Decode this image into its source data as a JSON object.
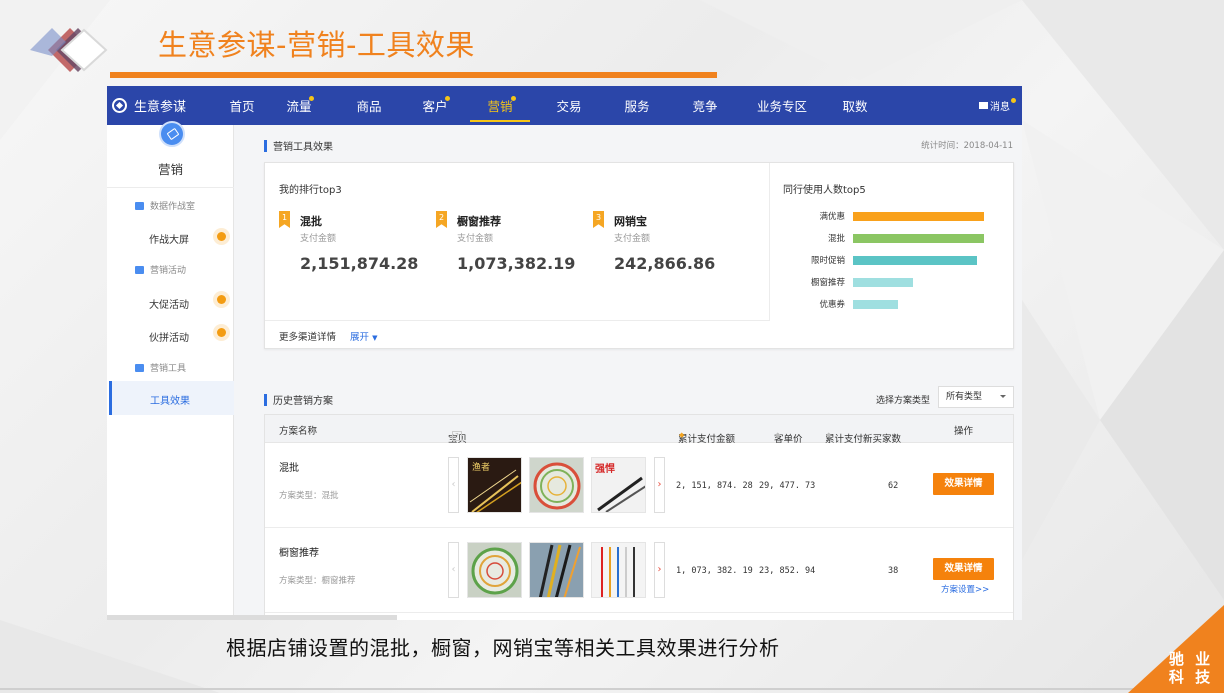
{
  "slide": {
    "title": "生意参谋-营销-工具效果",
    "caption": "根据店铺设置的混批，橱窗，网销宝等相关工具效果进行分析",
    "corner_line1": "驰 业",
    "corner_line2": "科 技",
    "accent": "#f0821e"
  },
  "navbar": {
    "brand": "生意参谋",
    "items": [
      {
        "label": "首页",
        "dot": false,
        "active": false
      },
      {
        "label": "流量",
        "dot": true,
        "active": false
      },
      {
        "label": "商品",
        "dot": false,
        "active": false
      },
      {
        "label": "客户",
        "dot": true,
        "active": false
      },
      {
        "label": "营销",
        "dot": true,
        "active": true
      },
      {
        "label": "交易",
        "dot": false,
        "active": false
      },
      {
        "label": "服务",
        "dot": false,
        "active": false
      },
      {
        "label": "竞争",
        "dot": false,
        "active": false
      },
      {
        "label": "业务专区",
        "dot": false,
        "active": false
      },
      {
        "label": "取数",
        "dot": false,
        "active": false
      }
    ],
    "message": "消息",
    "bg": "#2b46a9"
  },
  "sidebar": {
    "title": "营销",
    "groups": [
      {
        "label": "数据作战室",
        "links": [
          {
            "label": "作战大屏",
            "dot": true
          }
        ]
      },
      {
        "label": "营销活动",
        "links": [
          {
            "label": "大促活动",
            "dot": true
          },
          {
            "label": "伙拼活动",
            "dot": true
          }
        ]
      },
      {
        "label": "营销工具",
        "links": [
          {
            "label": "工具效果",
            "active": true
          }
        ]
      }
    ]
  },
  "tool_effect": {
    "heading": "营销工具效果",
    "stat_time": "统计时间：2018-04-11",
    "my_rank_title": "我的排行top3",
    "ranks": [
      {
        "badge": "1",
        "name": "混批",
        "sub": "支付金额",
        "amount": "2,151,874.28"
      },
      {
        "badge": "2",
        "name": "橱窗推荐",
        "sub": "支付金额",
        "amount": "1,073,382.19"
      },
      {
        "badge": "3",
        "name": "网销宝",
        "sub": "支付金额",
        "amount": "242,866.86"
      }
    ],
    "more_channels": "更多渠道详情",
    "expand": "展开"
  },
  "chart_data": {
    "type": "bar",
    "orientation": "horizontal",
    "title": "同行使用人数top5",
    "categories": [
      "满优惠",
      "混批",
      "限时促销",
      "橱窗推荐",
      "优惠券"
    ],
    "values": [
      100,
      100,
      95,
      46,
      34
    ],
    "colors": [
      "#f9a11b",
      "#8bc663",
      "#5bc4c5",
      "#9fdfe0",
      "#9fdfe0"
    ],
    "xlim": [
      0,
      100
    ],
    "grid": false
  },
  "history": {
    "heading": "历史营销方案",
    "select_label": "选择方案类型",
    "select_value": "所有类型",
    "columns": {
      "name": "方案名称",
      "items": "宝贝",
      "help": "?",
      "total_pay": "累计支付金额",
      "unit_price": "客单价",
      "new_buyers": "累计支付新买家数",
      "action": "操作"
    },
    "rows": [
      {
        "name": "混批",
        "type": "方案类型：混批",
        "total_pay": "2, 151, 874. 28",
        "unit_price": "29, 477. 73",
        "new_buyers": "62",
        "detail": "效果详情",
        "setting": "",
        "thumbs": [
          "rods-poster",
          "ring-net",
          "rod-pair"
        ],
        "thumb_text_1": "渔者",
        "thumb_text_3": "强悍"
      },
      {
        "name": "橱窗推荐",
        "type": "方案类型：橱窗推荐",
        "total_pay": "1, 073, 382. 19",
        "unit_price": "23, 852. 94",
        "new_buyers": "38",
        "detail": "效果详情",
        "setting": "方案设置>>",
        "thumbs": [
          "ring-net",
          "color-rods",
          "straight-rods"
        ]
      }
    ]
  }
}
